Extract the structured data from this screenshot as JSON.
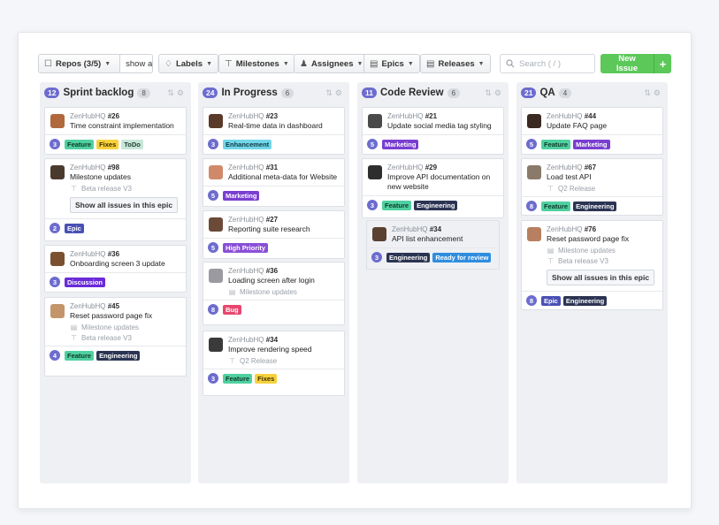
{
  "toolbar": {
    "repos_label": "Repos (3/5)",
    "show_all_label": "show all",
    "labels_label": "Labels",
    "milestones_label": "Milestones",
    "assignees_label": "Assignees",
    "epics_label": "Epics",
    "releases_label": "Releases",
    "search_placeholder": "Search ( / )",
    "new_issue_label": "New Issue",
    "new_issue_plus": "+"
  },
  "colors": {
    "primary_badge": "#6c6ccf",
    "new_issue_green": "#5cc85a",
    "label_feature": "#4fd0a0",
    "label_fixes": "#f7d13d",
    "label_todo": "#c6e6d8",
    "label_epic": "#4a50b4",
    "label_discussion": "#6a2bd8",
    "label_engineering": "#2b3452",
    "label_enhancement": "#72d6e8",
    "label_marketing": "#7a3ed0",
    "label_high_priority": "#8a4fd8",
    "label_bug": "#e8466e",
    "label_ready_for_review": "#2f8de0"
  },
  "columns": [
    {
      "points": "12",
      "name": "Sprint backlog",
      "count": "8",
      "cards": [
        {
          "repo": "ZenHubHQ",
          "num": "#26",
          "title": "Time constraint implementation",
          "meta": [],
          "epic_button": "",
          "estimate": "3",
          "labels": [
            {
              "text": "Feature"
            },
            {
              "text": "Fixes"
            },
            {
              "text": "ToDo"
            }
          ]
        },
        {
          "repo": "ZenHubHQ",
          "num": "#98",
          "title": "Milestone updates",
          "meta": [
            "Beta release V3"
          ],
          "epic_button": "Show all issues in this epic",
          "estimate": "2",
          "labels": [
            {
              "text": "Epic"
            }
          ]
        },
        {
          "repo": "ZenHubHQ",
          "num": "#36",
          "title": "Onboarding screen 3 update",
          "meta": [],
          "epic_button": "",
          "estimate": "3",
          "labels": [
            {
              "text": "Discussion"
            }
          ]
        },
        {
          "repo": "ZenHubHQ",
          "num": "#45",
          "title": "Reset password page fix",
          "meta": [
            "Milestone updates",
            "Beta release V3"
          ],
          "epic_button": "",
          "estimate": "4",
          "labels": [
            {
              "text": "Feature"
            },
            {
              "text": "Engineering"
            }
          ]
        }
      ]
    },
    {
      "points": "24",
      "name": "In Progress",
      "count": "6",
      "cards": [
        {
          "repo": "ZenHubHQ",
          "num": "#23",
          "title": "Real-time data in dashboard",
          "meta": [],
          "estimate": "3",
          "labels": [
            {
              "text": "Enhancement"
            }
          ]
        },
        {
          "repo": "ZenHubHQ",
          "num": "#31",
          "title": "Additional meta-data for Website",
          "meta": [],
          "estimate": "5",
          "labels": [
            {
              "text": "Marketing"
            }
          ]
        },
        {
          "repo": "ZenHubHQ",
          "num": "#27",
          "title": "Reporting suite research",
          "meta": [],
          "estimate": "5",
          "labels": [
            {
              "text": "High Priority"
            }
          ]
        },
        {
          "repo": "ZenHubHQ",
          "num": "#36",
          "title": "Loading screen after login",
          "meta": [
            "Milestone updates"
          ],
          "estimate": "8",
          "labels": [
            {
              "text": "Bug"
            }
          ]
        },
        {
          "repo": "ZenHubHQ",
          "num": "#34",
          "title": "Improve rendering speed",
          "meta": [
            "Q2 Release"
          ],
          "estimate": "3",
          "labels": [
            {
              "text": "Feature"
            },
            {
              "text": "Fixes"
            }
          ]
        }
      ]
    },
    {
      "points": "11",
      "name": "Code Review",
      "count": "6",
      "cards": [
        {
          "repo": "ZenHubHQ",
          "num": "#21",
          "title": "Update social media tag styling",
          "meta": [],
          "estimate": "5",
          "labels": [
            {
              "text": "Marketing"
            }
          ]
        },
        {
          "repo": "ZenHubHQ",
          "num": "#29",
          "title": "Improve API documentation on new website",
          "meta": [],
          "estimate": "3",
          "labels": [
            {
              "text": "Feature"
            },
            {
              "text": "Engineering"
            }
          ]
        },
        {
          "repo": "ZenHubHQ",
          "num": "#34",
          "title": "API list enhancement",
          "meta": [],
          "estimate": "3",
          "labels": [
            {
              "text": "Engineering"
            },
            {
              "text": "Ready for review"
            }
          ]
        }
      ]
    },
    {
      "points": "21",
      "name": "QA",
      "count": "4",
      "cards": [
        {
          "repo": "ZenHubHQ",
          "num": "#44",
          "title": "Update FAQ page",
          "meta": [],
          "estimate": "5",
          "labels": [
            {
              "text": "Feature"
            },
            {
              "text": "Marketing"
            }
          ]
        },
        {
          "repo": "ZenHubHQ",
          "num": "#67",
          "title": "Load test API",
          "meta": [
            "Q2 Release"
          ],
          "estimate": "8",
          "labels": [
            {
              "text": "Feature"
            },
            {
              "text": "Engineering"
            }
          ]
        },
        {
          "repo": "ZenHubHQ",
          "num": "#76",
          "title": "Reset password page fix",
          "meta": [
            "Milestone updates",
            "Beta release V3"
          ],
          "epic_button": "Show all issues in this epic",
          "estimate": "8",
          "labels": [
            {
              "text": "Epic"
            },
            {
              "text": "Engineering"
            }
          ]
        }
      ]
    }
  ]
}
